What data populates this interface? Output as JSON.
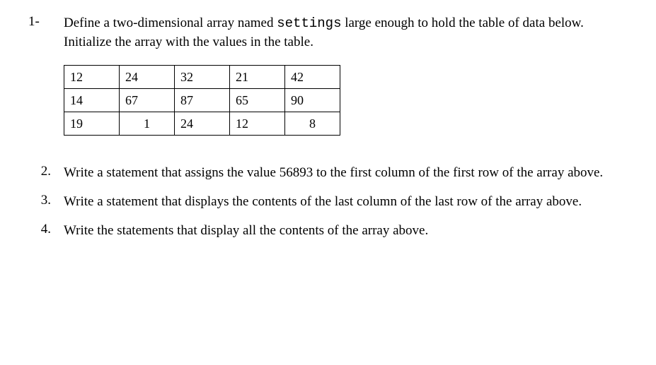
{
  "questions": {
    "q1": {
      "number": "1-",
      "text_before": "Define a two-dimensional array named ",
      "code": "settings",
      "text_after": " large enough to hold the table of data below. Initialize the array with the values in the table."
    },
    "q2": {
      "number": "2.",
      "text": "Write a statement that assigns the value 56893 to the first column of the first row of the array above."
    },
    "q3": {
      "number": "3.",
      "text": "Write a statement that displays the contents of the last column of the last row of the array above."
    },
    "q4": {
      "number": "4.",
      "text": "Write the statements that display all the contents of the array above."
    }
  },
  "table": {
    "rows": [
      [
        "12",
        "24",
        "32",
        "21",
        "42"
      ],
      [
        "14",
        "67",
        "87",
        "65",
        "90"
      ],
      [
        "19",
        "1",
        "24",
        "12",
        "8"
      ]
    ]
  },
  "chart_data": {
    "type": "table",
    "title": "",
    "columns": 5,
    "rows": 3,
    "data": [
      [
        12,
        24,
        32,
        21,
        42
      ],
      [
        14,
        67,
        87,
        65,
        90
      ],
      [
        19,
        1,
        24,
        12,
        8
      ]
    ]
  }
}
